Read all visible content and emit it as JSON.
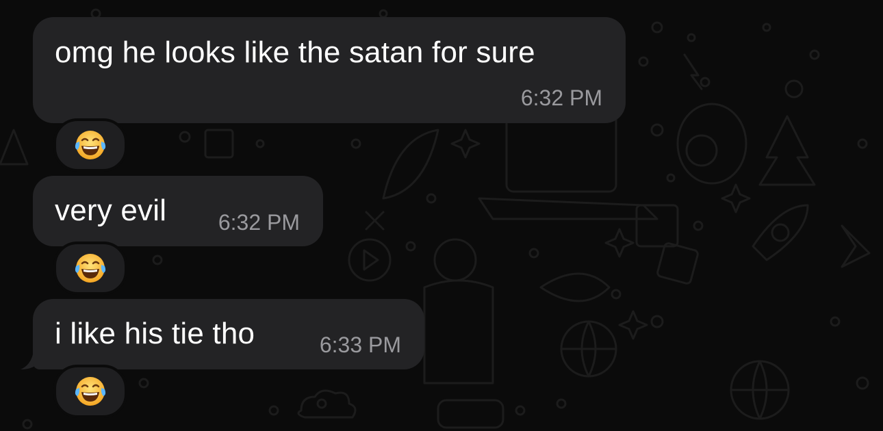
{
  "messages": [
    {
      "text": "omg he looks like the satan for sure",
      "time": "6:32 PM",
      "reaction": "face-with-tears-of-joy"
    },
    {
      "text": "very evil",
      "time": "6:32 PM",
      "reaction": "face-with-tears-of-joy"
    },
    {
      "text": "i like his tie tho",
      "time": "6:33 PM",
      "reaction": "face-with-tears-of-joy"
    }
  ],
  "colors": {
    "background": "#0b0b0b",
    "bubble": "#232325",
    "text": "#ffffff",
    "timestamp": "#9a9a9e",
    "reaction_bg": "#1f1f21"
  }
}
